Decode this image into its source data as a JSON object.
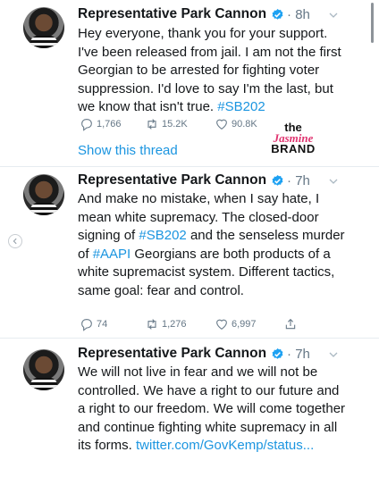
{
  "tweets": [
    {
      "author": "Representative Park Cannon",
      "time": "8h",
      "text_parts": [
        {
          "t": "Hey everyone, thank you for your support. I've been released from jail. I am not the first Georgian to be arrested for fighting voter suppression. I'd love to say I'm the last, but we know that isn't true. ",
          "link": false
        },
        {
          "t": "#SB202",
          "link": true
        }
      ],
      "replies": "1,766",
      "retweets": "15.2K",
      "likes": "90.8K",
      "show_thread": "Show this thread"
    },
    {
      "author": "Representative Park Cannon",
      "time": "7h",
      "text_parts": [
        {
          "t": "And make no mistake, when I say hate, I mean white supremacy. The closed-door signing of ",
          "link": false
        },
        {
          "t": "#SB202",
          "link": true
        },
        {
          "t": " and the senseless murder of ",
          "link": false
        },
        {
          "t": "#AAPI",
          "link": true
        },
        {
          "t": " Georgians are both products of a white supremacist system. Different tactics, same goal: fear and control.",
          "link": false
        }
      ],
      "replies": "74",
      "retweets": "1,276",
      "likes": "6,997"
    },
    {
      "author": "Representative Park Cannon",
      "time": "7h",
      "text_parts": [
        {
          "t": "We will not live in fear and we will not be controlled. We have a right to our future and a right to our freedom. We will come together and continue fighting white supremacy in all its forms. ",
          "link": false
        },
        {
          "t": "twitter.com/GovKemp/status...",
          "link": true
        }
      ]
    }
  ],
  "watermark": {
    "line1": "the",
    "line2": "Jasmine",
    "line3": "BRAND"
  },
  "colors": {
    "link": "#1b95e0",
    "muted": "#657786",
    "verified": "#1da1f2",
    "brand_pink": "#e0336f"
  }
}
